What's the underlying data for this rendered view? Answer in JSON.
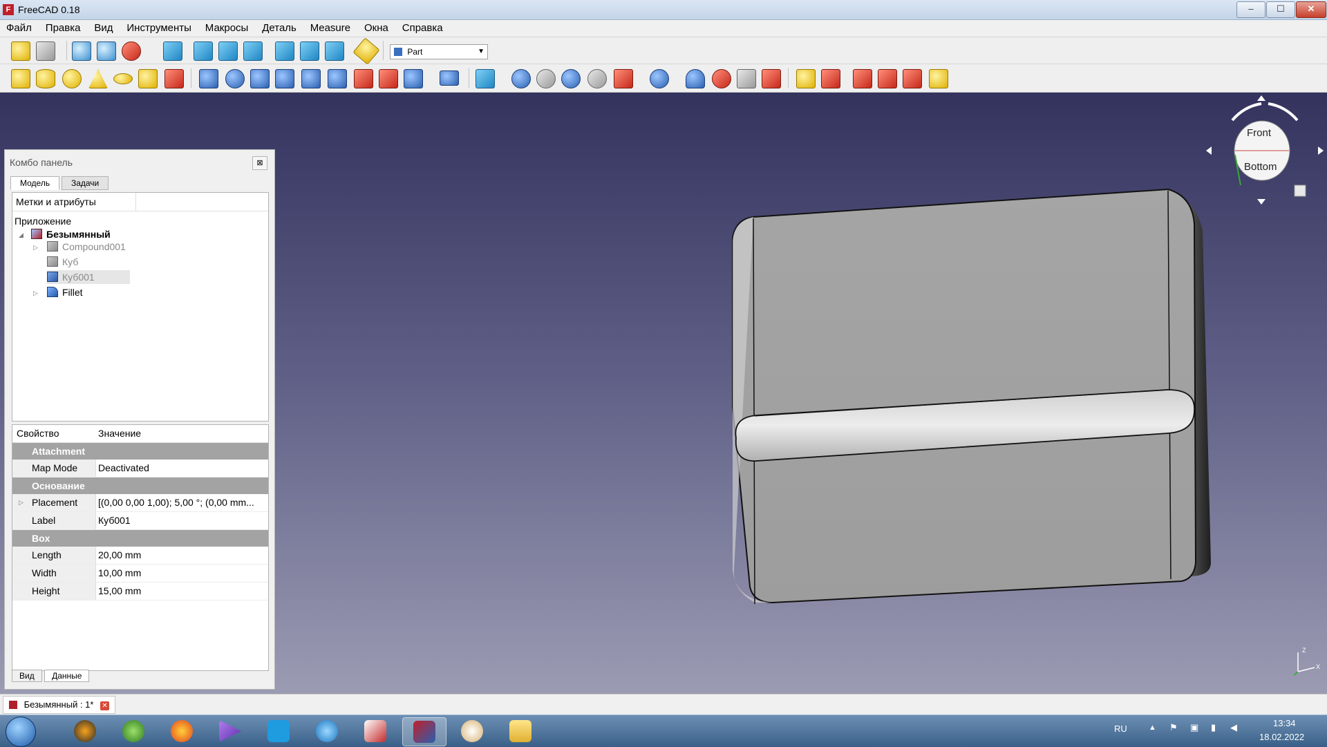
{
  "window": {
    "title": "FreeCAD 0.18",
    "app_icon": "F"
  },
  "window_controls": [
    "–",
    "☐",
    "✕"
  ],
  "menu": [
    "Файл",
    "Правка",
    "Вид",
    "Инструменты",
    "Макросы",
    "Деталь",
    "Measure",
    "Окна",
    "Справка"
  ],
  "workbench": {
    "selected": "Part"
  },
  "combo": {
    "title": "Комбо панель",
    "close": "⊠",
    "tabs": [
      "Модель",
      "Задачи"
    ],
    "tree_header": "Метки и атрибуты",
    "tree": {
      "root": "Приложение",
      "document": "Безымянный",
      "items": [
        {
          "label": "Compound001",
          "icon": "compound-icon",
          "expandable": true
        },
        {
          "label": "Куб",
          "icon": "cube-icon",
          "expandable": false
        },
        {
          "label": "Куб001",
          "icon": "cube-icon",
          "expandable": false,
          "selected": true
        },
        {
          "label": "Fillet",
          "icon": "fillet-icon",
          "expandable": true
        }
      ]
    },
    "props": {
      "col_property": "Свойство",
      "col_value": "Значение",
      "groups": [
        {
          "name": "Attachment",
          "rows": [
            {
              "name": "Map Mode",
              "value": "Deactivated"
            }
          ]
        },
        {
          "name": "Основание",
          "rows": [
            {
              "name": "Placement",
              "value": "[(0,00 0,00 1,00); 5,00 °; (0,00 mm...",
              "expandable": true
            },
            {
              "name": "Label",
              "value": "Куб001"
            }
          ]
        },
        {
          "name": "Box",
          "rows": [
            {
              "name": "Length",
              "value": "20,00 mm"
            },
            {
              "name": "Width",
              "value": "10,00 mm"
            },
            {
              "name": "Height",
              "value": "15,00 mm"
            }
          ]
        }
      ]
    },
    "bottom_tabs": [
      "Вид",
      "Данные"
    ]
  },
  "navcube": {
    "front": "Front",
    "bottom": "Bottom"
  },
  "axis": {
    "x": "X",
    "z": "Z"
  },
  "document_tab": {
    "label": "Безымянный : 1*",
    "close": "✕"
  },
  "taskbar": {
    "lang": "RU",
    "time": "13:34",
    "date": "18.02.2022"
  }
}
